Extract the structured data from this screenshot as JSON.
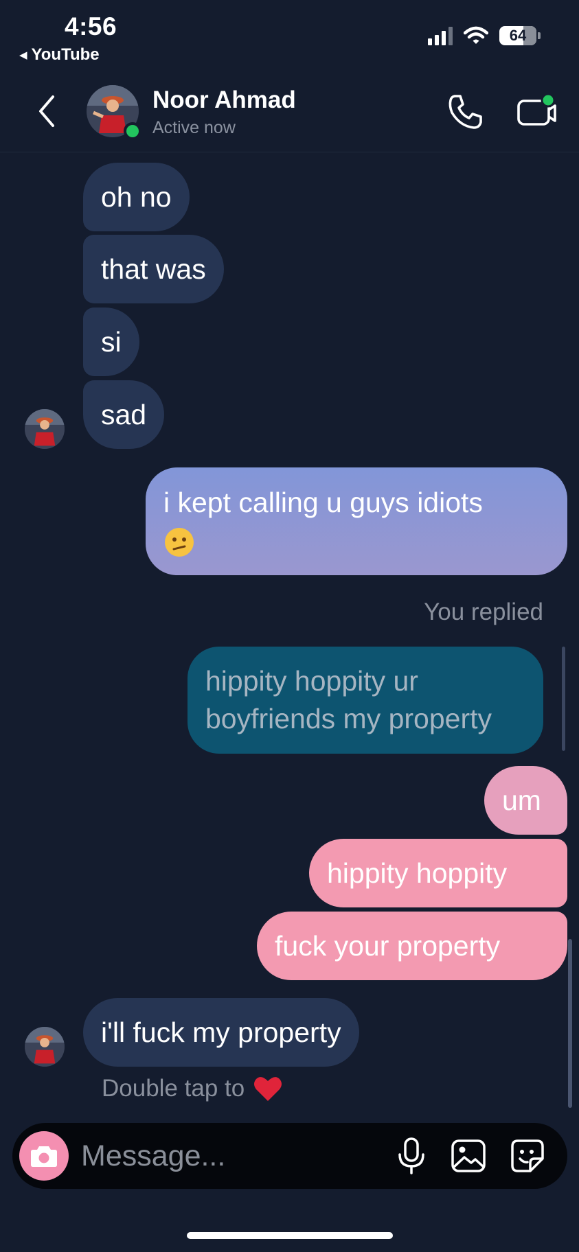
{
  "status_bar": {
    "time": "4:56",
    "back_app": "YouTube",
    "battery_level": "64"
  },
  "header": {
    "contact_name": "Noor Ahmad",
    "contact_status": "Active now"
  },
  "messages": [
    {
      "from": "contact",
      "text": "oh no"
    },
    {
      "from": "contact",
      "text": "that was"
    },
    {
      "from": "contact",
      "text": "si"
    },
    {
      "from": "contact",
      "text": "sad"
    },
    {
      "from": "me",
      "text": "i kept calling u guys idiots",
      "emoji": "confused-face"
    },
    {
      "from": "me",
      "label": "You replied",
      "reply_quote": "hippity hoppity ur boyfriends my property"
    },
    {
      "from": "me",
      "text": "um"
    },
    {
      "from": "me",
      "text": "hippity hoppity"
    },
    {
      "from": "me",
      "text": "fuck your property"
    },
    {
      "from": "contact",
      "text": "i'll fuck my property"
    }
  ],
  "double_tap_hint": "Double tap to",
  "composer": {
    "placeholder": "Message..."
  },
  "colors": {
    "background": "#141c2e",
    "received_bubble": "#263553",
    "sent_blue": "#8a97d6",
    "sent_pink": "#f39ab1",
    "reply_bubble": "#0d5470",
    "online": "#22c55e",
    "camera": "#f48fb1"
  },
  "icons": [
    "back-icon",
    "phone-icon",
    "video-icon",
    "camera-icon",
    "microphone-icon",
    "gallery-icon",
    "sticker-icon",
    "heart-icon",
    "confused-face-icon"
  ]
}
